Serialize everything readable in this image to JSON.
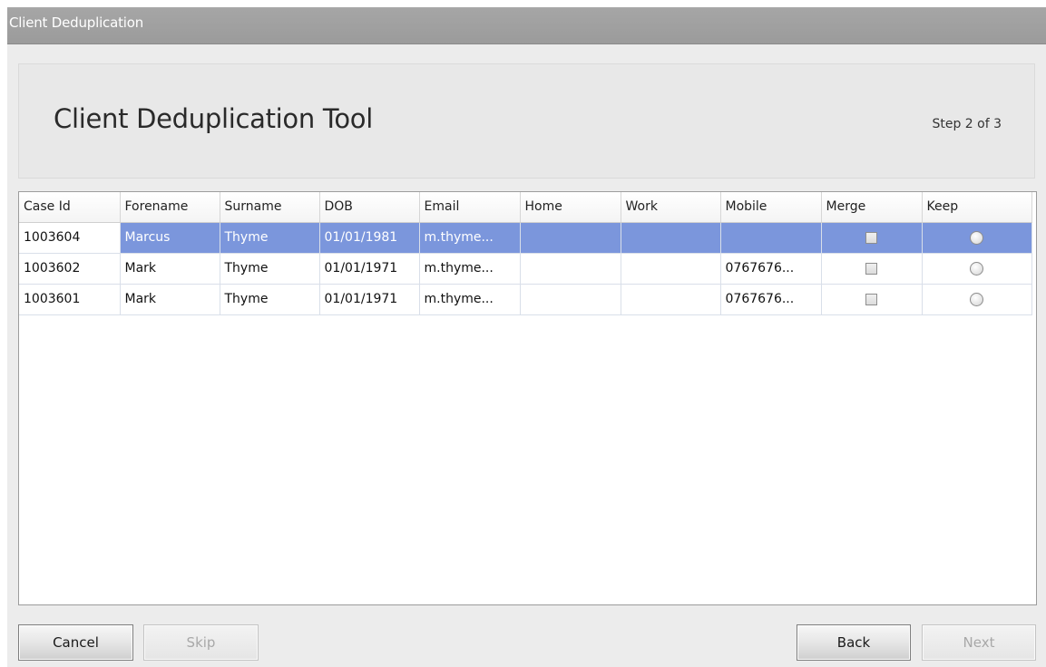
{
  "window": {
    "title": "Client Deduplication"
  },
  "header": {
    "title": "Client Deduplication Tool",
    "step": "Step 2 of 3"
  },
  "grid": {
    "columns": [
      "Case Id",
      "Forename",
      "Surname",
      "DOB",
      "Email",
      "Home",
      "Work",
      "Mobile",
      "Merge",
      "Keep"
    ],
    "rows": [
      {
        "case_id": "1003604",
        "forename": "Marcus",
        "surname": "Thyme",
        "dob": "01/01/1981",
        "email": "m.thyme...",
        "home": "",
        "work": "",
        "mobile": "",
        "merge_checked": false,
        "keep_selected": false,
        "selected": true
      },
      {
        "case_id": "1003602",
        "forename": "Mark",
        "surname": "Thyme",
        "dob": "01/01/1971",
        "email": "m.thyme...",
        "home": "",
        "work": "",
        "mobile": "0767676...",
        "merge_checked": false,
        "keep_selected": false,
        "selected": false
      },
      {
        "case_id": "1003601",
        "forename": "Mark",
        "surname": "Thyme",
        "dob": "01/01/1971",
        "email": "m.thyme...",
        "home": "",
        "work": "",
        "mobile": "0767676...",
        "merge_checked": false,
        "keep_selected": false,
        "selected": false
      }
    ]
  },
  "buttons": {
    "cancel": "Cancel",
    "skip": "Skip",
    "back": "Back",
    "next": "Next"
  },
  "colors": {
    "selection": "#7b96dc",
    "titlebar": "#a6a6a6",
    "window_bg": "#ececec"
  }
}
